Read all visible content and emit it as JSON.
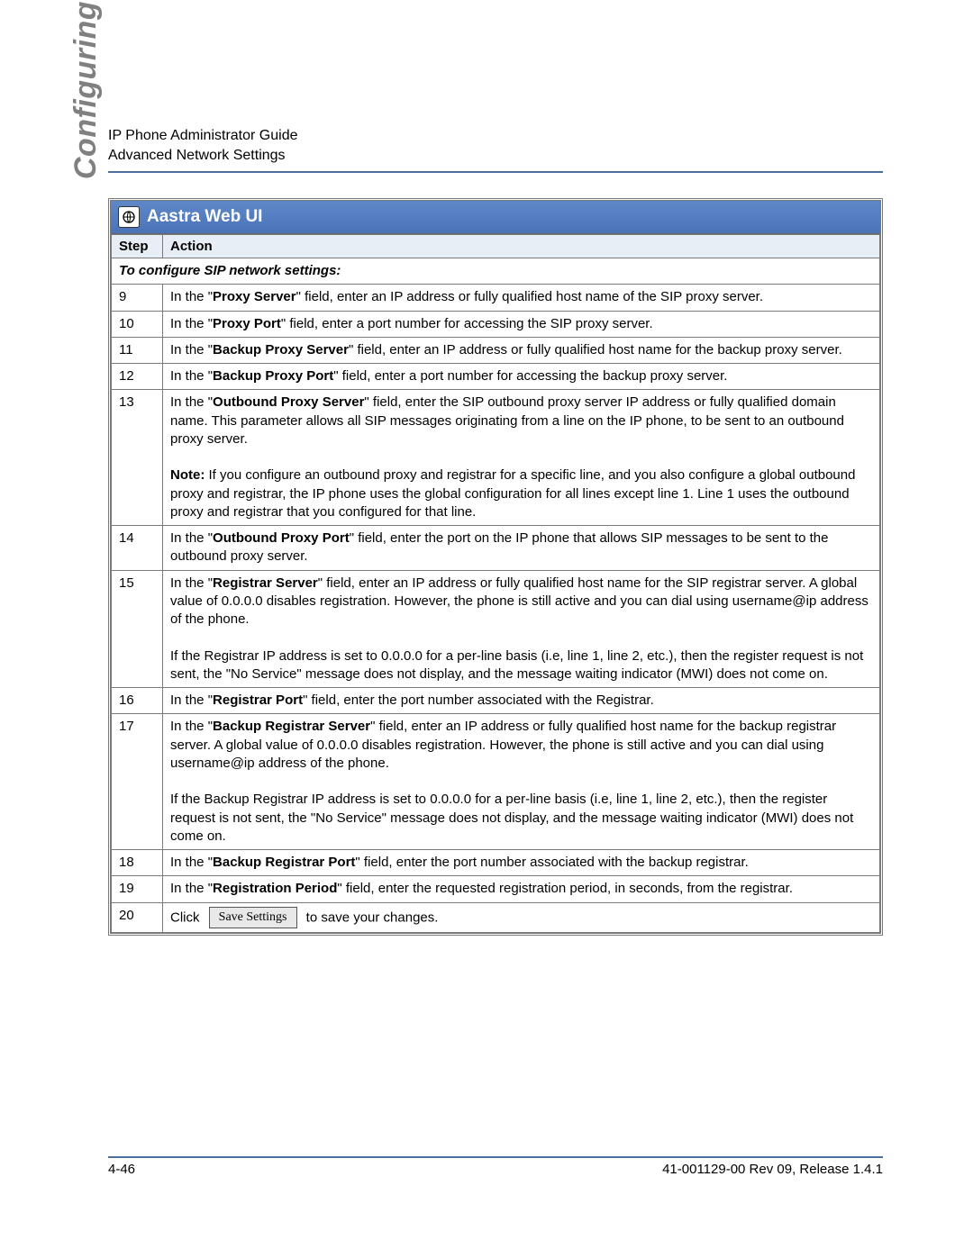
{
  "header": {
    "line1": "IP Phone Administrator Guide",
    "line2": "Advanced Network Settings"
  },
  "side_label": "Configuring the IP Phones",
  "title_bar": "Aastra Web UI",
  "table": {
    "col_step": "Step",
    "col_action": "Action",
    "subheading": "To configure SIP network settings:"
  },
  "rows": [
    {
      "step": "9",
      "pre": "In the \"",
      "bold": "Proxy Server",
      "post": "\" field, enter an IP address or fully qualified host name of the SIP proxy server."
    },
    {
      "step": "10",
      "pre": "In the \"",
      "bold": "Proxy Port",
      "post": "\" field, enter a port number for accessing the SIP proxy server."
    },
    {
      "step": "11",
      "pre": "In the \"",
      "bold": "Backup Proxy Server",
      "post": "\" field, enter an IP address or fully qualified host name for the backup proxy server."
    },
    {
      "step": "12",
      "pre": "In the \"",
      "bold": "Backup Proxy Port",
      "post": "\" field, enter a port number for accessing the backup proxy server."
    },
    {
      "step": "13",
      "pre": "In the \"",
      "bold": "Outbound Proxy Server",
      "post": "\" field, enter the SIP outbound proxy server IP address or fully qualified domain name. This parameter allows all SIP messages originating from a line on the IP phone, to be sent to an outbound proxy server.",
      "note_label": "Note:",
      "note": " If you configure an outbound proxy and registrar for a specific line, and you also configure a global outbound proxy and registrar, the IP phone uses the global configuration for all lines except line 1. Line 1 uses the outbound proxy and registrar that you configured for that line."
    },
    {
      "step": "14",
      "pre": "In the \"",
      "bold": "Outbound Proxy Port",
      "post": "\" field, enter the port on the IP phone that allows SIP messages to be sent to the outbound proxy server."
    },
    {
      "step": "15",
      "pre": "In the \"",
      "bold": "Registrar Server",
      "post": "\" field, enter an IP address or fully qualified host name for the SIP registrar server. A global value of 0.0.0.0 disables registration. However, the phone is still active and you can dial using username@ip address of the phone.",
      "extra": "If the Registrar IP address is set to 0.0.0.0 for a per-line basis (i.e, line 1, line 2, etc.), then the register request is not sent, the \"No Service\" message does not display, and the message waiting indicator (MWI) does not come on."
    },
    {
      "step": "16",
      "pre": "In the \"",
      "bold": "Registrar Port",
      "post": "\" field, enter the port number associated with the Registrar."
    },
    {
      "step": "17",
      "pre": "In the \"",
      "bold": "Backup Registrar Server",
      "post": "\" field, enter an IP address or fully qualified host name for the backup registrar server. A global value of 0.0.0.0 disables registration. However, the phone is still active and you can dial using username@ip address of the phone.",
      "extra": "If the Backup Registrar IP address is set to 0.0.0.0 for a per-line basis (i.e, line 1, line 2, etc.), then the register request is not sent, the \"No Service\" message does not display, and the message waiting indicator (MWI) does not come on."
    },
    {
      "step": "18",
      "pre": "In the \"",
      "bold": "Backup Registrar Port",
      "post": "\" field, enter the port number associated with the backup registrar."
    },
    {
      "step": "19",
      "pre": "In the \"",
      "bold": "Registration Period",
      "post": "\" field, enter the requested registration period, in seconds, from the registrar."
    }
  ],
  "row20": {
    "step": "20",
    "click": "Click",
    "button": "Save Settings",
    "after": "to save your changes."
  },
  "footer": {
    "left": "4-46",
    "right": "41-001129-00 Rev 09, Release 1.4.1"
  }
}
